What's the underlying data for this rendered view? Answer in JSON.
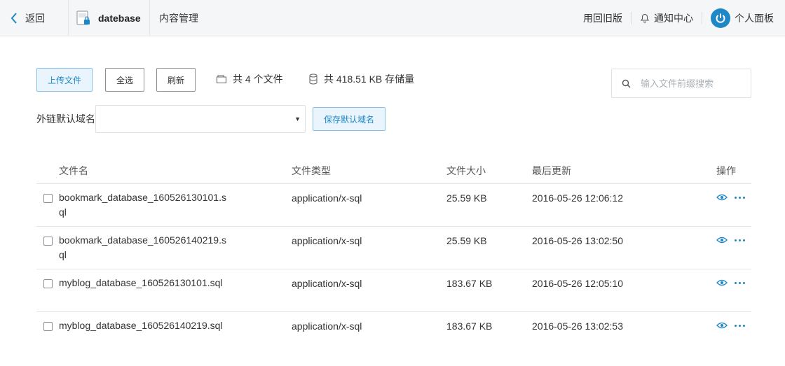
{
  "header": {
    "back_label": "返回",
    "bucket_name": "datebase",
    "crumb": "内容管理",
    "old_version": "用回旧版",
    "notifications": "通知中心",
    "personal_panel": "个人面板"
  },
  "toolbar": {
    "upload_label": "上传文件",
    "select_all_label": "全选",
    "refresh_label": "刷新",
    "file_count_text": "共 4 个文件",
    "storage_text": "共 418.51 KB 存储量",
    "search_placeholder": "输入文件前缀搜索"
  },
  "domain": {
    "label": "外链默认域名",
    "value": "",
    "save_label": "保存默认域名"
  },
  "table": {
    "headers": {
      "name": "文件名",
      "type": "文件类型",
      "size": "文件大小",
      "updated": "最后更新",
      "actions": "操作"
    },
    "rows": [
      {
        "name": "bookmark_database_160526130101.sql",
        "type": "application/x-sql",
        "size": "25.59 KB",
        "updated": "2016-05-26 12:06:12"
      },
      {
        "name": "bookmark_database_160526140219.sql",
        "type": "application/x-sql",
        "size": "25.59 KB",
        "updated": "2016-05-26 13:02:50"
      },
      {
        "name": "myblog_database_160526130101.sql",
        "type": "application/x-sql",
        "size": "183.67 KB",
        "updated": "2016-05-26 12:05:10"
      },
      {
        "name": "myblog_database_160526140219.sql",
        "type": "application/x-sql",
        "size": "183.67 KB",
        "updated": "2016-05-26 13:02:53"
      }
    ]
  },
  "colors": {
    "accent": "#1e88c7",
    "header_bg": "#f5f6f8",
    "border": "#e3e5e8"
  },
  "icons": [
    "chevron-left-icon",
    "bucket-icon",
    "bell-icon",
    "power-icon",
    "folder-icon",
    "database-icon",
    "search-icon",
    "eye-icon",
    "more-icon"
  ]
}
